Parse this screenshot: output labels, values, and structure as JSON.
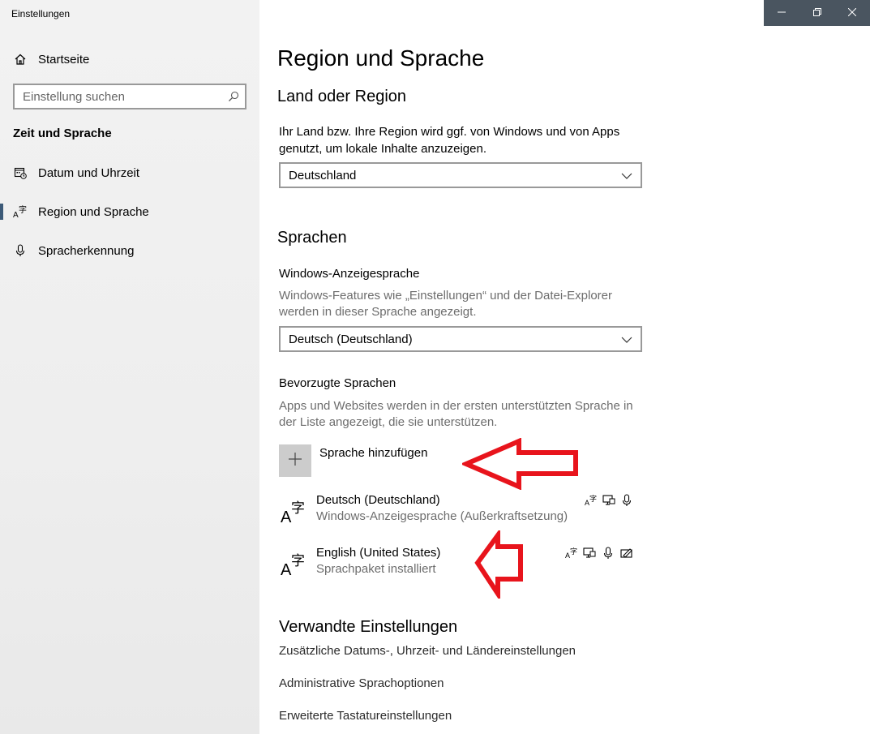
{
  "window": {
    "title": "Einstellungen"
  },
  "sidebar": {
    "home_label": "Startseite",
    "search_placeholder": "Einstellung suchen",
    "section_title": "Zeit und Sprache",
    "items": [
      {
        "label": "Datum und Uhrzeit",
        "icon": "calendar-clock-icon",
        "active": false
      },
      {
        "label": "Region und Sprache",
        "icon": "language-icon",
        "active": true
      },
      {
        "label": "Spracherkennung",
        "icon": "microphone-icon",
        "active": false
      }
    ]
  },
  "main": {
    "page_title": "Region und Sprache",
    "region": {
      "heading": "Land oder Region",
      "description_line1": "Ihr Land bzw. Ihre Region wird ggf. von Windows und von Apps",
      "description_line2": "genutzt, um lokale Inhalte anzuzeigen.",
      "selected": "Deutschland"
    },
    "languages": {
      "heading": "Sprachen",
      "display_language_label": "Windows-Anzeigesprache",
      "display_language_desc_line1": "Windows-Features wie „Einstellungen“ und der Datei-Explorer",
      "display_language_desc_line2": "werden in dieser Sprache angezeigt.",
      "display_language_selected": "Deutsch (Deutschland)",
      "preferred_label": "Bevorzugte Sprachen",
      "preferred_desc_line1": "Apps und Websites werden in der ersten unterstützten Sprache in",
      "preferred_desc_line2": "der Liste angezeigt, die sie unterstützen.",
      "add_label": "Sprache hinzufügen",
      "list": [
        {
          "name": "Deutsch (Deutschland)",
          "status": "Windows-Anzeigesprache (Außerkraftsetzung)",
          "features": [
            "language-pack-icon",
            "display-icon",
            "microphone-icon"
          ]
        },
        {
          "name": "English (United States)",
          "status": "Sprachpaket installiert",
          "features": [
            "language-pack-icon",
            "display-icon",
            "microphone-icon",
            "handwriting-icon"
          ]
        }
      ]
    },
    "related": {
      "heading": "Verwandte Einstellungen",
      "links": [
        "Zusätzliche Datums-, Uhrzeit- und Ländereinstellungen",
        "Administrative Sprachoptionen",
        "Erweiterte Tastatureinstellungen"
      ]
    }
  },
  "annotations": {
    "arrow_color": "#e8141c"
  }
}
